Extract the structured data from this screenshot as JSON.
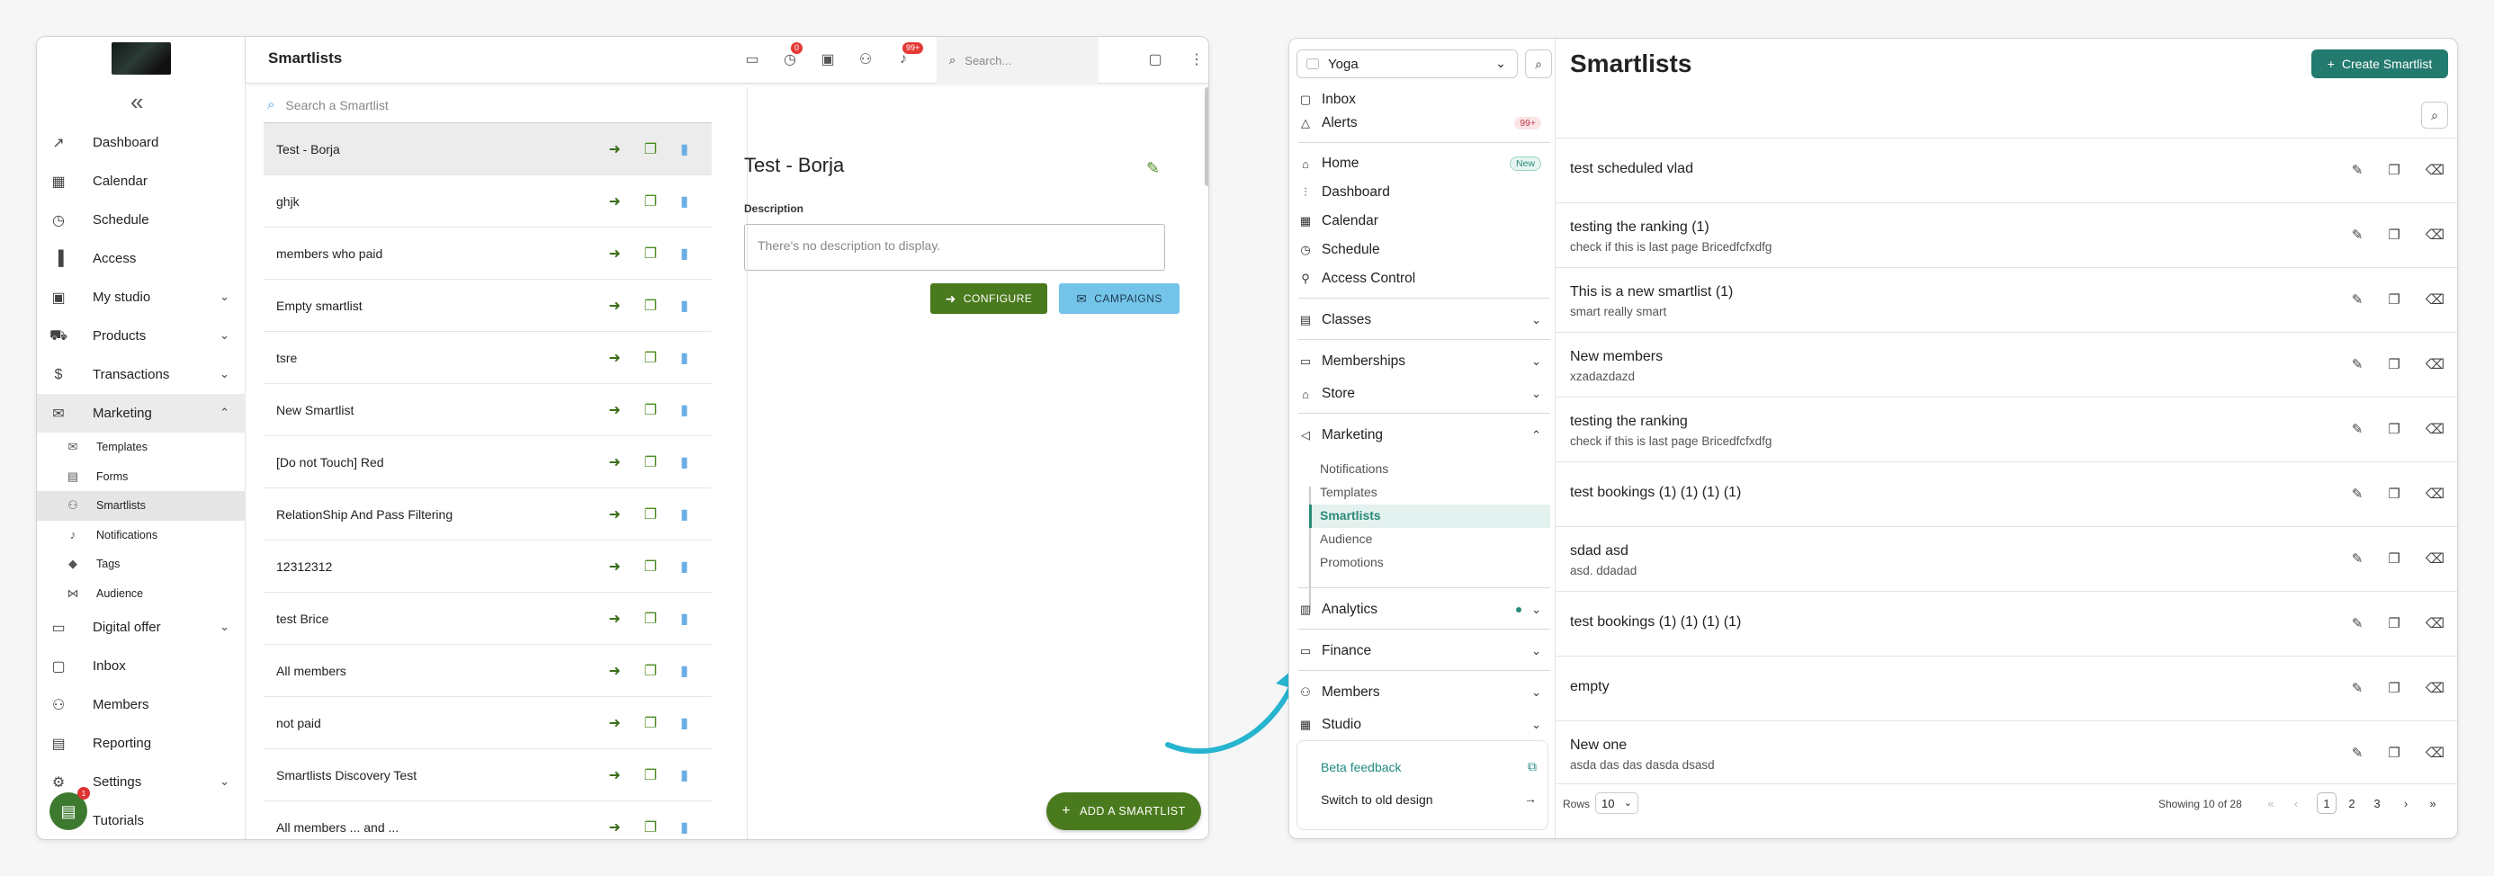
{
  "old": {
    "sidebar": {
      "items": [
        {
          "label": "Dashboard",
          "icon": "trending-up-icon",
          "chevron": false
        },
        {
          "label": "Calendar",
          "icon": "calendar-icon",
          "chevron": false
        },
        {
          "label": "Schedule",
          "icon": "clock-icon",
          "chevron": false
        },
        {
          "label": "Access",
          "icon": "door-icon",
          "chevron": false
        },
        {
          "label": "My studio",
          "icon": "briefcase-icon",
          "chevron": true
        },
        {
          "label": "Products",
          "icon": "cart-icon",
          "chevron": true
        },
        {
          "label": "Transactions",
          "icon": "dollar-icon",
          "chevron": true
        },
        {
          "label": "Marketing",
          "icon": "mail-icon",
          "chevron": true
        }
      ],
      "marketing_sub": [
        {
          "label": "Templates",
          "icon": "mail-icon"
        },
        {
          "label": "Forms",
          "icon": "clipboard-icon"
        },
        {
          "label": "Smartlists",
          "icon": "people-icon"
        },
        {
          "label": "Notifications",
          "icon": "bell-icon"
        },
        {
          "label": "Tags",
          "icon": "tag-icon"
        },
        {
          "label": "Audience",
          "icon": "graph-icon"
        }
      ],
      "items_after": [
        {
          "label": "Digital offer",
          "icon": "laptop-icon",
          "chevron": true
        },
        {
          "label": "Inbox",
          "icon": "chat-icon",
          "chevron": false
        },
        {
          "label": "Members",
          "icon": "people-icon",
          "chevron": false
        },
        {
          "label": "Reporting",
          "icon": "document-icon",
          "chevron": false
        },
        {
          "label": "Settings",
          "icon": "gear-icon",
          "chevron": true
        },
        {
          "label": "Tutorials",
          "icon": "school-icon",
          "chevron": false
        }
      ],
      "chat_badge": "1"
    },
    "header": {
      "title": "Smartlists",
      "timer_badge": "0",
      "notif_badge": "99+",
      "search_placeholder": "Search..."
    },
    "list": {
      "search_placeholder": "Search a Smartlist",
      "rows": [
        "Test - Borja",
        "ghjk",
        "members who paid",
        "Empty smartlist",
        "tsre",
        "New Smartlist",
        "[Do not Touch] Red",
        "RelationShip And Pass Filtering",
        "12312312",
        "test Brice",
        "All members",
        "not paid",
        "Smartlists Discovery Test",
        "All members ... and ..."
      ]
    },
    "detail": {
      "title": "Test - Borja",
      "description_label": "Description",
      "description_placeholder": "There's no description to display.",
      "configure": "CONFIGURE",
      "campaigns": "CAMPAIGNS",
      "add": "ADD A SMARTLIST"
    }
  },
  "new": {
    "workspace": "Yoga",
    "nav": {
      "inbox": "Inbox",
      "alerts": "Alerts",
      "alerts_badge": "99+",
      "home": "Home",
      "home_badge": "New",
      "dashboard": "Dashboard",
      "calendar": "Calendar",
      "schedule": "Schedule",
      "access_control": "Access Control",
      "classes": "Classes",
      "memberships": "Memberships",
      "store": "Store",
      "marketing": "Marketing",
      "marketing_sub": [
        "Notifications",
        "Templates",
        "Smartlists",
        "Audience",
        "Promotions"
      ],
      "analytics": "Analytics",
      "finance": "Finance",
      "members": "Members",
      "studio": "Studio"
    },
    "footer": {
      "beta": "Beta feedback",
      "switch": "Switch to old design"
    },
    "main": {
      "title": "Smartlists",
      "create": "Create Smartlist",
      "rows": [
        {
          "title": "test scheduled vlad",
          "desc": ""
        },
        {
          "title": "testing the ranking (1)",
          "desc": "check if this is last page Bricedfcfxdfg"
        },
        {
          "title": "This is a new smartlist (1)",
          "desc": "smart really smart"
        },
        {
          "title": "New members",
          "desc": "xzadazdazd"
        },
        {
          "title": "testing the ranking",
          "desc": "check if this is last page Bricedfcfxdfg"
        },
        {
          "title": "test bookings (1) (1) (1) (1)",
          "desc": ""
        },
        {
          "title": "sdad asd",
          "desc": "asd. ddadad"
        },
        {
          "title": "test bookings (1) (1) (1) (1)",
          "desc": ""
        },
        {
          "title": "empty",
          "desc": ""
        },
        {
          "title": "New one",
          "desc": "asda das das dasda dsasd"
        }
      ],
      "pager": {
        "rows_label": "Rows",
        "rows_value": "10",
        "showing": "Showing 10 of 28",
        "pages": [
          "1",
          "2",
          "3"
        ]
      }
    }
  },
  "colors": {
    "old_green": "#4a7a1e",
    "old_blue": "#74c4ea",
    "new_teal": "#237a6e",
    "arrow": "#27b4cf"
  }
}
